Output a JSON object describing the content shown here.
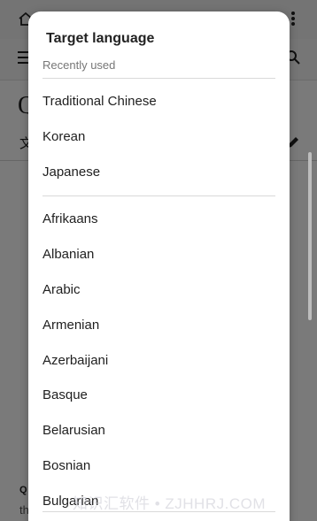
{
  "background": {
    "title_letter": "Q",
    "translate_glyph": "文",
    "bottom_text_1": "Q",
    "bottom_text_2": "th"
  },
  "dialog": {
    "title": "Target language",
    "recent_label": "Recently used",
    "recent": [
      {
        "label": "Traditional Chinese"
      },
      {
        "label": "Korean"
      },
      {
        "label": "Japanese"
      }
    ],
    "all": [
      {
        "label": "Afrikaans"
      },
      {
        "label": "Albanian"
      },
      {
        "label": "Arabic"
      },
      {
        "label": "Armenian"
      },
      {
        "label": "Azerbaijani"
      },
      {
        "label": "Basque"
      },
      {
        "label": "Belarusian"
      },
      {
        "label": "Bosnian"
      },
      {
        "label": "Bulgarian"
      }
    ]
  },
  "watermark": "知识汇软件 • ZJHHRJ.COM",
  "colors": {
    "scrim": "#000000",
    "dialog_bg": "#ffffff",
    "text": "#1f1f1f",
    "muted": "#777777"
  },
  "icons": [
    "home-icon",
    "menu-icon",
    "search-icon",
    "more-vert-icon",
    "translate-icon",
    "edit-icon"
  ]
}
